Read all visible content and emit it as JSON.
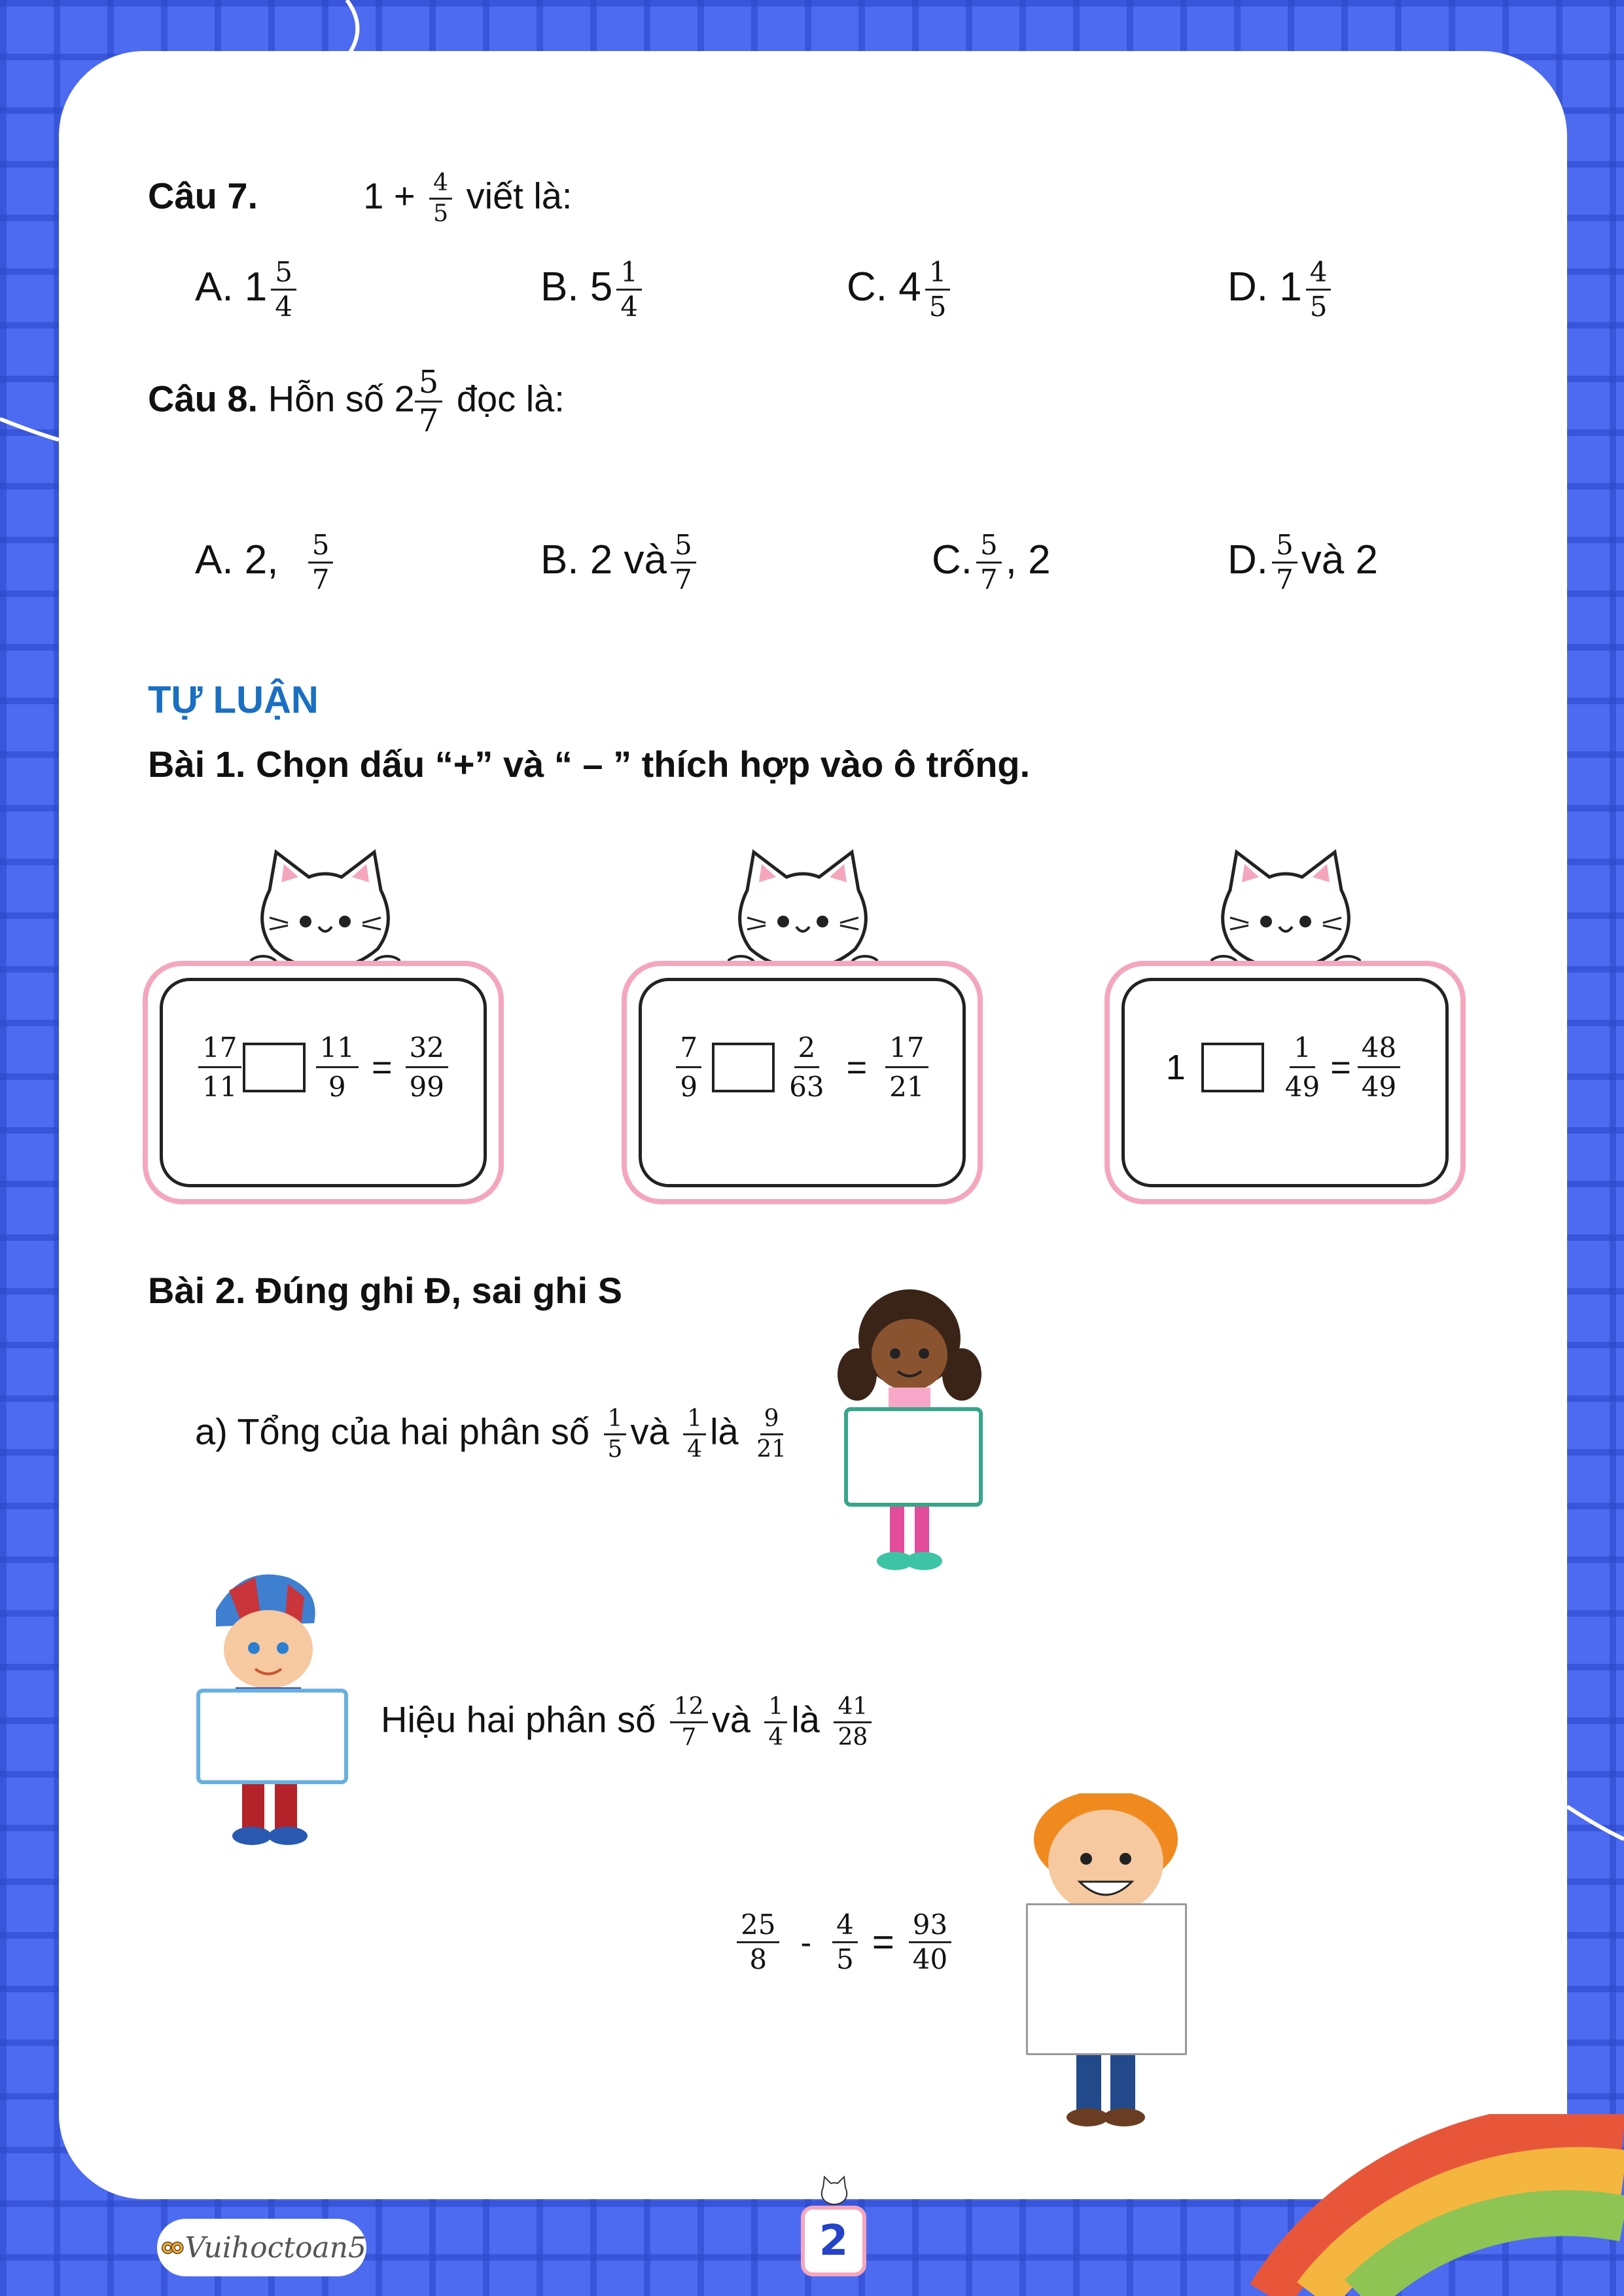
{
  "q7": {
    "label": "Câu 7.",
    "expr_whole": "1 +",
    "expr_num": "4",
    "expr_den": "5",
    "expr_tail": "viết là:",
    "options": [
      {
        "letter": "A. 1",
        "num": "5",
        "den": "4"
      },
      {
        "letter": "B. 5",
        "num": "1",
        "den": "4"
      },
      {
        "letter": "C. 4",
        "num": "1",
        "den": "5"
      },
      {
        "letter": "D. 1",
        "num": "4",
        "den": "5"
      }
    ]
  },
  "q8": {
    "label": "Câu 8.",
    "text_before": "Hỗn số 2",
    "num": "5",
    "den": "7",
    "text_after": "đọc là:",
    "options": {
      "a_prefix": "A. 2,",
      "a_num": "5",
      "a_den": "7",
      "b_prefix": "B. 2 và",
      "b_num": "5",
      "b_den": "7",
      "c_prefix": "C.",
      "c_num": "5",
      "c_den": "7",
      "c_suffix": ", 2",
      "d_prefix": "D.",
      "d_num": "5",
      "d_den": "7",
      "d_suffix": "và 2"
    }
  },
  "section_title": "TỰ LUẬN",
  "bai1": {
    "title": "Bài 1. Chọn dấu  “+”  và  “ – ”  thích hợp vào ô trống.",
    "boards": [
      {
        "a_num": "17",
        "a_den": "11",
        "b_num": "11",
        "b_den": "9",
        "eq": "=",
        "r_num": "32",
        "r_den": "99"
      },
      {
        "a_num": "7",
        "a_den": "9",
        "b_num": "2",
        "b_den": "63",
        "eq": "=",
        "r_num": "17",
        "r_den": "21"
      },
      {
        "whole": "1",
        "b_num": "1",
        "b_den": "49",
        "eq": "=",
        "r_num": "48",
        "r_den": "49"
      }
    ]
  },
  "bai2": {
    "title": "Bài 2. Đúng ghi Đ, sai ghi S",
    "a": {
      "prefix": "a) Tổng của hai phân số",
      "n1": "1",
      "d1": "5",
      "and": "và",
      "n2": "1",
      "d2": "4",
      "is": "là",
      "n3": "9",
      "d3": "21"
    },
    "b": {
      "prefix": "Hiệu hai phân số",
      "n1": "12",
      "d1": "7",
      "and": "và",
      "n2": "1",
      "d2": "4",
      "is": "là",
      "n3": "41",
      "d3": "28"
    },
    "c": {
      "n1": "25",
      "d1": "8",
      "minus": "-",
      "n2": "4",
      "d2": "5",
      "eq": "=",
      "n3": "93",
      "d3": "40"
    }
  },
  "footer": {
    "brand": "Vuihoctoan5",
    "page": "2"
  },
  "colors": {
    "background": "#4d6bf0",
    "heading": "#1a6fc2",
    "board_border": "#f4a6bd"
  }
}
